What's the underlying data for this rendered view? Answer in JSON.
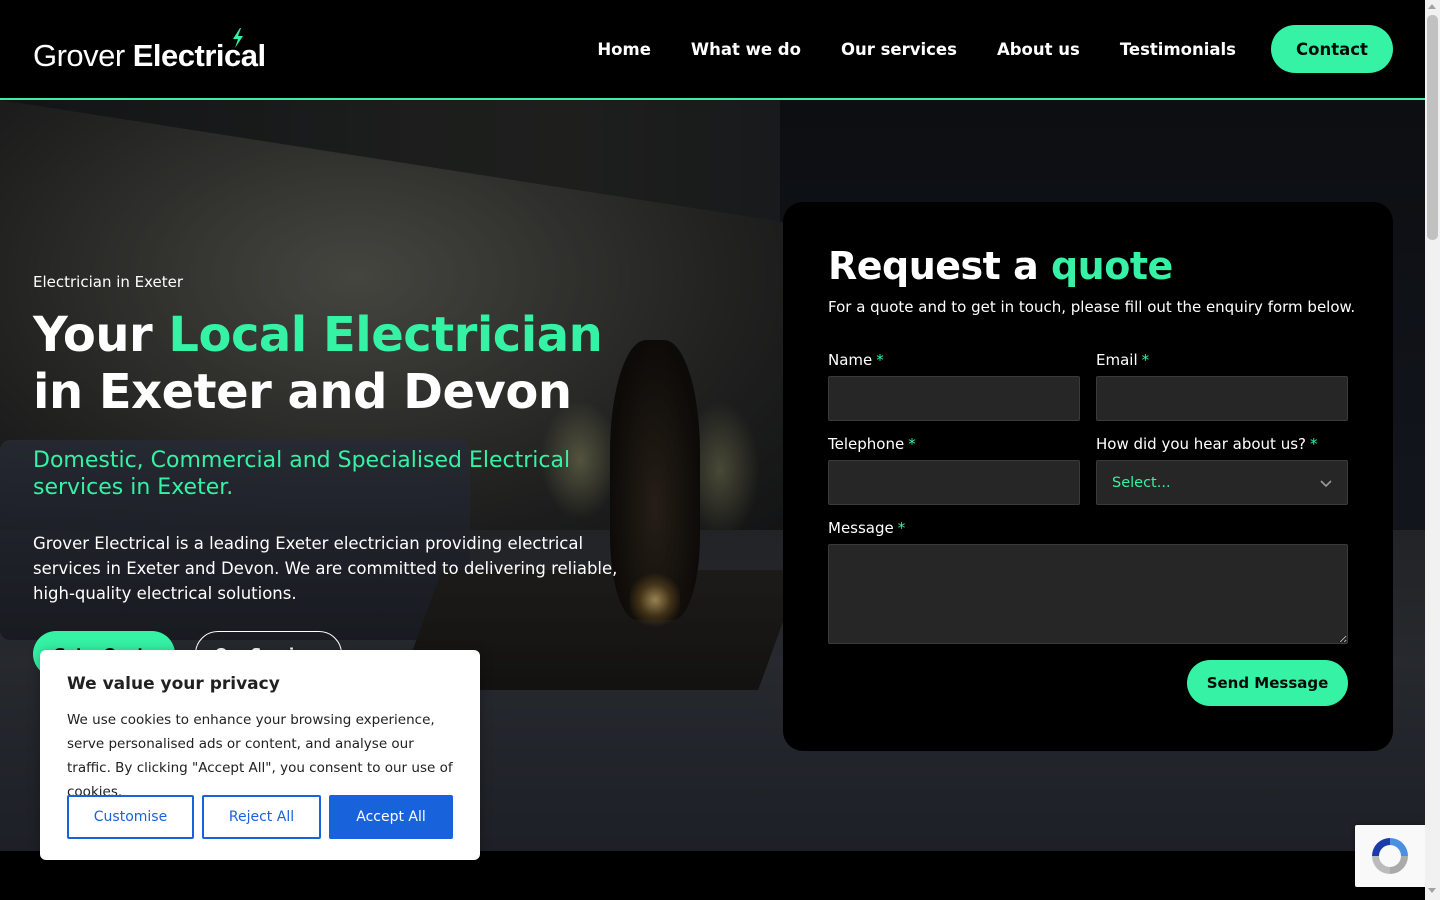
{
  "header": {
    "logo_light": "Grover",
    "logo_bold": "Electrical",
    "nav": [
      "Home",
      "What we do",
      "Our services",
      "About us",
      "Testimonials"
    ],
    "contact_label": "Contact",
    "accent_color": "#35f2a4"
  },
  "hero": {
    "eyebrow": "Electrician in Exeter",
    "title_part1": "Your ",
    "title_highlight": "Local Electrician",
    "title_part2": " in Exeter and Devon",
    "subtitle": "Domestic, Commercial and Specialised Electrical services in Exeter.",
    "paragraph": "Grover Electrical is a leading Exeter electrician providing electrical services in Exeter and Devon. We are committed to delivering reliable, high-quality electrical solutions.",
    "btn_quote": "Get a Quote",
    "btn_services": "Our Services"
  },
  "quote_form": {
    "title_part1": "Request a ",
    "title_highlight": "quote",
    "subtitle": "For a quote and to get in touch, please fill out the enquiry form below.",
    "name_label": "Name",
    "email_label": "Email",
    "telephone_label": "Telephone",
    "hear_label": "How did you hear about us?",
    "hear_value": "Select...",
    "message_label": "Message",
    "required_mark": "*",
    "send_label": "Send Message"
  },
  "cookie": {
    "title": "We value your privacy",
    "text": "We use cookies to enhance your browsing experience, serve personalised ads or content, and analyse our traffic. By clicking \"Accept All\", you consent to our use of cookies.",
    "customise": "Customise",
    "reject": "Reject All",
    "accept": "Accept All",
    "button_color": "#1863dc"
  }
}
